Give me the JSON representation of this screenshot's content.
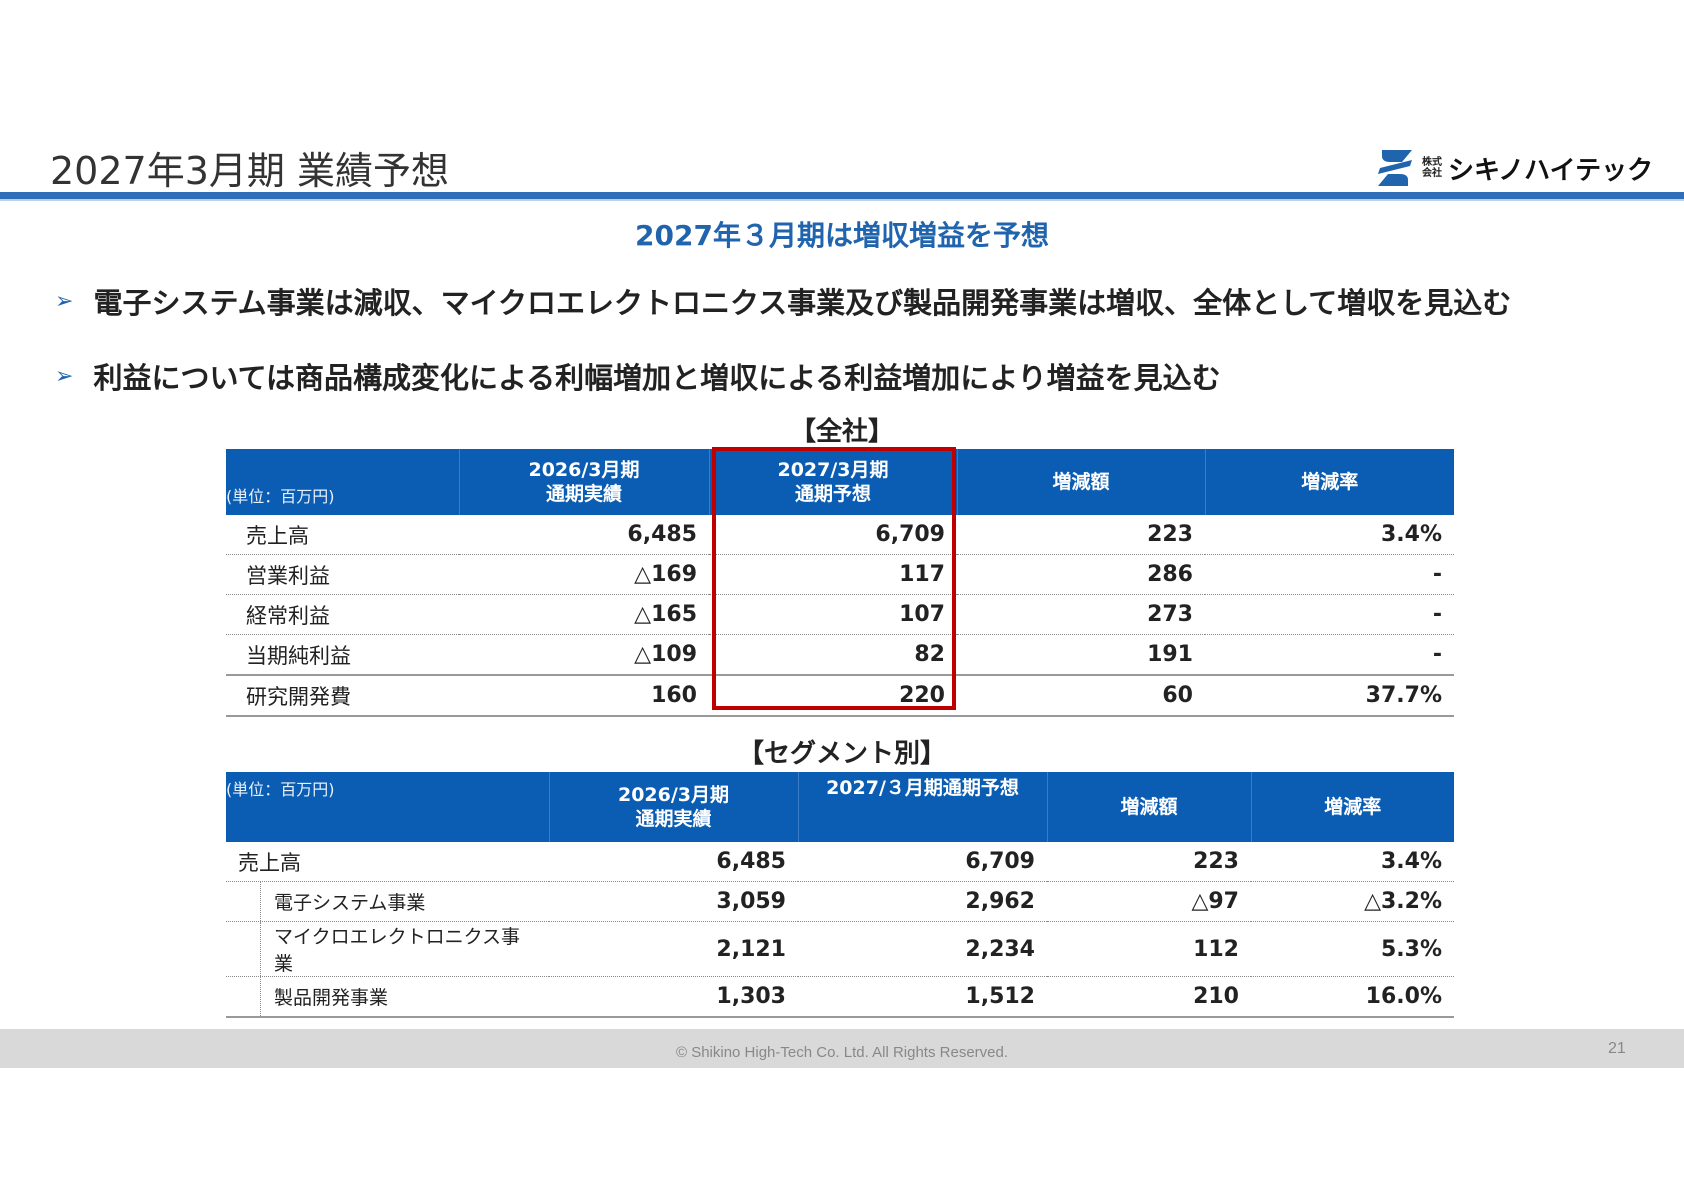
{
  "header": {
    "title": "2027年3月期 業績予想",
    "logo_prefix_top": "株式",
    "logo_prefix_bottom": "会社",
    "logo_text": "シキノハイテック"
  },
  "subtitle": "2027年３月期は増収増益を予想",
  "bullets": [
    "電子システム事業は減収、マイクロエレクトロニクス事業及び製品開発事業は増収、全体として増収を見込む",
    "利益については商品構成変化による利幅増加と増収による利益増加により増益を見込む"
  ],
  "company_table": {
    "label": "【全社】",
    "headers": [
      "(単位：百万円)",
      "2026/3月期",
      "通期実績",
      "2027/3月期",
      "通期予想",
      "増減額",
      "増減率"
    ],
    "rows": [
      [
        "売上高",
        "6,485",
        "6,709",
        "223",
        "3.4%"
      ],
      [
        "営業利益",
        "△169",
        "117",
        "286",
        "-"
      ],
      [
        "経常利益",
        "△165",
        "107",
        "273",
        "-"
      ],
      [
        "当期純利益",
        "△109",
        "82",
        "191",
        "-"
      ],
      [
        "研究開発費",
        "160",
        "220",
        "60",
        "37.7%"
      ]
    ]
  },
  "segment_table": {
    "label": "【セグメント別】",
    "headers": [
      "(単位：百万円)",
      "2026/3月期",
      "通期実績",
      "2027/３月期通期予想",
      "増減額",
      "増減率"
    ],
    "rows": [
      [
        "売上高",
        "6,485",
        "6,709",
        "223",
        "3.4%"
      ],
      [
        "電子システム事業",
        "3,059",
        "2,962",
        "△97",
        "△3.2%"
      ],
      [
        "マイクロエレクトロニクス事業",
        "2,121",
        "2,234",
        "112",
        "5.3%"
      ],
      [
        "製品開発事業",
        "1,303",
        "1,512",
        "210",
        "16.0%"
      ]
    ]
  },
  "colors": {
    "accent": "#0b5db3",
    "highlight": "#c00000"
  },
  "footer": {
    "copyright": "© Shikino High-Tech Co. Ltd. All Rights Reserved.",
    "page": "21"
  }
}
